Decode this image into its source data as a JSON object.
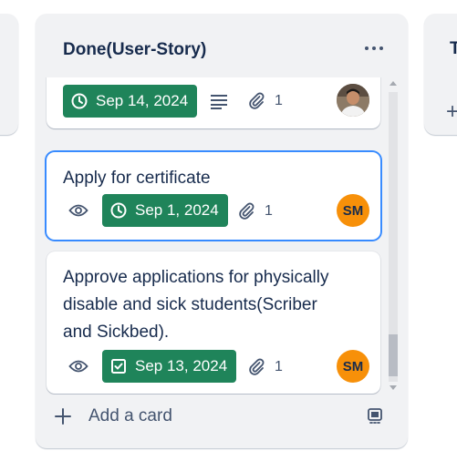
{
  "right_list": {
    "title_partial": "T"
  },
  "list": {
    "title": "Done(User-Story)",
    "add_card_label": "Add a card"
  },
  "cards": [
    {
      "title": "",
      "date": "Sep 14, 2024",
      "date_icon": "clock-icon",
      "has_description": true,
      "attachments": "1",
      "member": {
        "type": "photo"
      }
    },
    {
      "title": "Apply for certificate",
      "watching": true,
      "date": "Sep 1, 2024",
      "date_icon": "clock-icon",
      "attachments": "1",
      "member": {
        "initials": "SM"
      }
    },
    {
      "title_lines": [
        "Approve applications for physically",
        "disable and sick students(Scriber",
        "and Sickbed)."
      ],
      "watching": true,
      "date": "Sep 13, 2024",
      "date_icon": "checkbox-icon",
      "attachments": "1",
      "member": {
        "initials": "SM"
      }
    }
  ],
  "colors": {
    "list_bg": "#f1f2f4",
    "date_complete": "#1f845a",
    "avatar_orange": "#f79009",
    "focus_blue": "#388bff"
  }
}
